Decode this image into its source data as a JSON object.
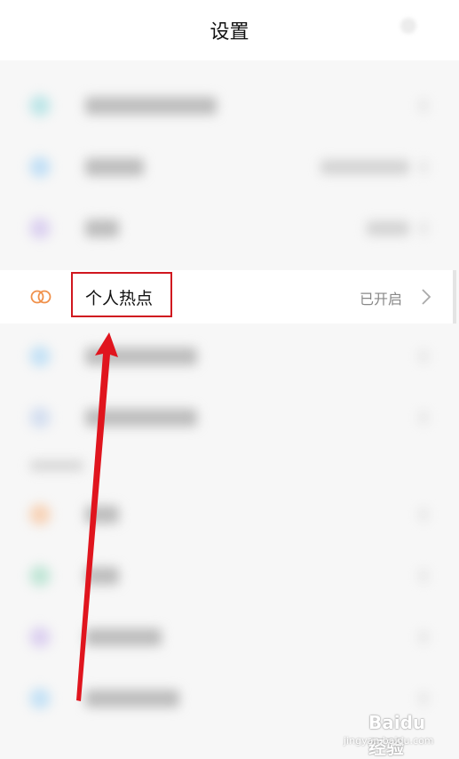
{
  "header": {
    "title": "设置"
  },
  "hotspot": {
    "label": "个人热点",
    "status": "已开启"
  },
  "watermark": {
    "text": "Baidu 经验",
    "url": "jingyan.baidu.com"
  },
  "colors": {
    "accent_red": "#d0171f",
    "hotspot_icon": "#f0904a",
    "status_gray": "#888888"
  },
  "icons": {
    "hotspot": "double-ring-icon",
    "chevron": "chevron-right-icon"
  }
}
